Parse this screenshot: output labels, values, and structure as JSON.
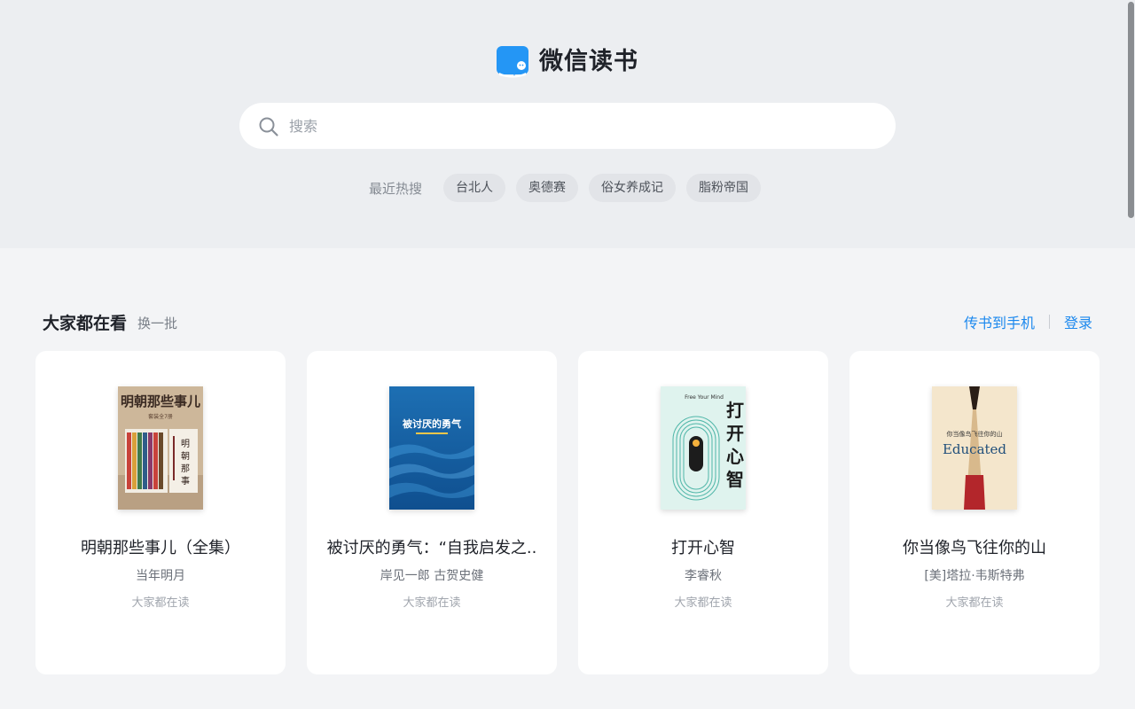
{
  "brand": {
    "name": "微信读书"
  },
  "search": {
    "placeholder": "搜索",
    "value": ""
  },
  "hot_searches": {
    "label": "最近热搜",
    "tags": [
      "台北人",
      "奥德赛",
      "俗女养成记",
      "脂粉帝国"
    ]
  },
  "section": {
    "title": "大家都在看",
    "refresh_label": "换一批",
    "send_to_phone": "传书到手机",
    "login": "登录"
  },
  "books": [
    {
      "title": "明朝那些事儿（全集）",
      "author": "当年明月",
      "tag": "大家都在读",
      "cover_text": "明朝那些事儿",
      "cover_subtext": "套装全7册"
    },
    {
      "title": "被讨厌的勇气：“自我启发之..",
      "author": "岸见一郎 古贺史健",
      "tag": "大家都在读",
      "cover_text": "被讨厌的勇气"
    },
    {
      "title": "打开心智",
      "author": "李睿秋",
      "tag": "大家都在读",
      "cover_text": "打开心智",
      "cover_en": "Free Your Mind"
    },
    {
      "title": "你当像鸟飞往你的山",
      "author": "[美]塔拉·韦斯特弗",
      "tag": "大家都在读",
      "cover_text": "你当像鸟飞往你的山",
      "cover_en": "Educated"
    }
  ],
  "colors": {
    "accent": "#1b88ee",
    "logo_blue": "#2496f5",
    "header_bg": "#eceef1",
    "page_bg": "#f3f4f6"
  }
}
